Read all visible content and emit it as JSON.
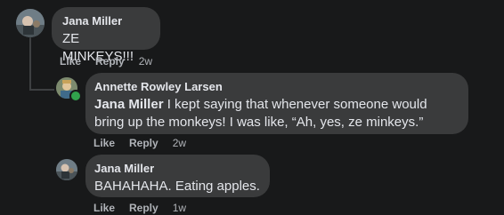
{
  "comments": [
    {
      "author": "Jana Miller",
      "text": "ZE MINKEYS!!!",
      "like": "Like",
      "reply": "Reply",
      "time": "2w"
    },
    {
      "author": "Annette Rowley Larsen",
      "mention": "Jana Miller",
      "text": " I kept saying that whenever someone would bring up the monkeys! I was like, “Ah, yes, ze minkeys.”",
      "like": "Like",
      "reply": "Reply",
      "time": "2w",
      "online": true
    },
    {
      "author": "Jana Miller",
      "text": "BAHAHAHA. Eating apples.",
      "like": "Like",
      "reply": "Reply",
      "time": "1w"
    }
  ],
  "colors": {
    "background": "#18191a",
    "bubble": "#3a3b3c",
    "text": "#e4e6eb",
    "secondary": "#b0b3b8",
    "online": "#31a24c"
  }
}
